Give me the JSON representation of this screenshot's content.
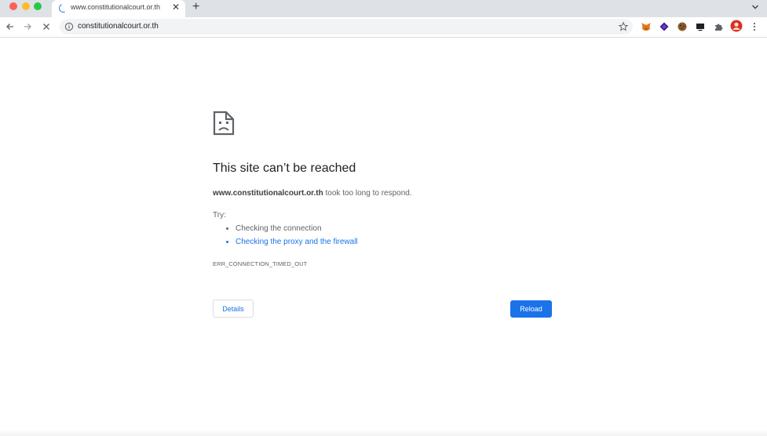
{
  "tab": {
    "title": "www.constitutionalcourt.or.th",
    "close_symbol": "✕"
  },
  "newtab_symbol": "+",
  "omnibox": {
    "url": "constitutionalcourt.or.th"
  },
  "toolbar": {
    "back_icon": "arrow-back-icon",
    "forward_icon": "arrow-forward-icon",
    "stop_icon": "stop-loading-icon",
    "star_icon": "bookmark-star-icon",
    "extensions": [
      "metamask-fox-icon",
      "purple-diamond-icon",
      "cookie-icon",
      "monitor-icon",
      "puzzle-piece-icon",
      "profile-avatar-icon",
      "kebab-menu-icon"
    ]
  },
  "error": {
    "icon": "sad-page-icon",
    "title": "This site can’t be reached",
    "host": "www.constitutionalcourt.or.th",
    "desc_suffix": " took too long to respond.",
    "try_label": "Try:",
    "suggestions": [
      {
        "text": "Checking the connection",
        "link": false
      },
      {
        "text": "Checking the proxy and the firewall",
        "link": true
      }
    ],
    "code": "ERR_CONNECTION_TIMED_OUT",
    "details_label": "Details",
    "reload_label": "Reload"
  },
  "colors": {
    "accent": "#1a73e8",
    "tabstrip": "#dee1e6",
    "omnibox": "#f1f3f4"
  }
}
